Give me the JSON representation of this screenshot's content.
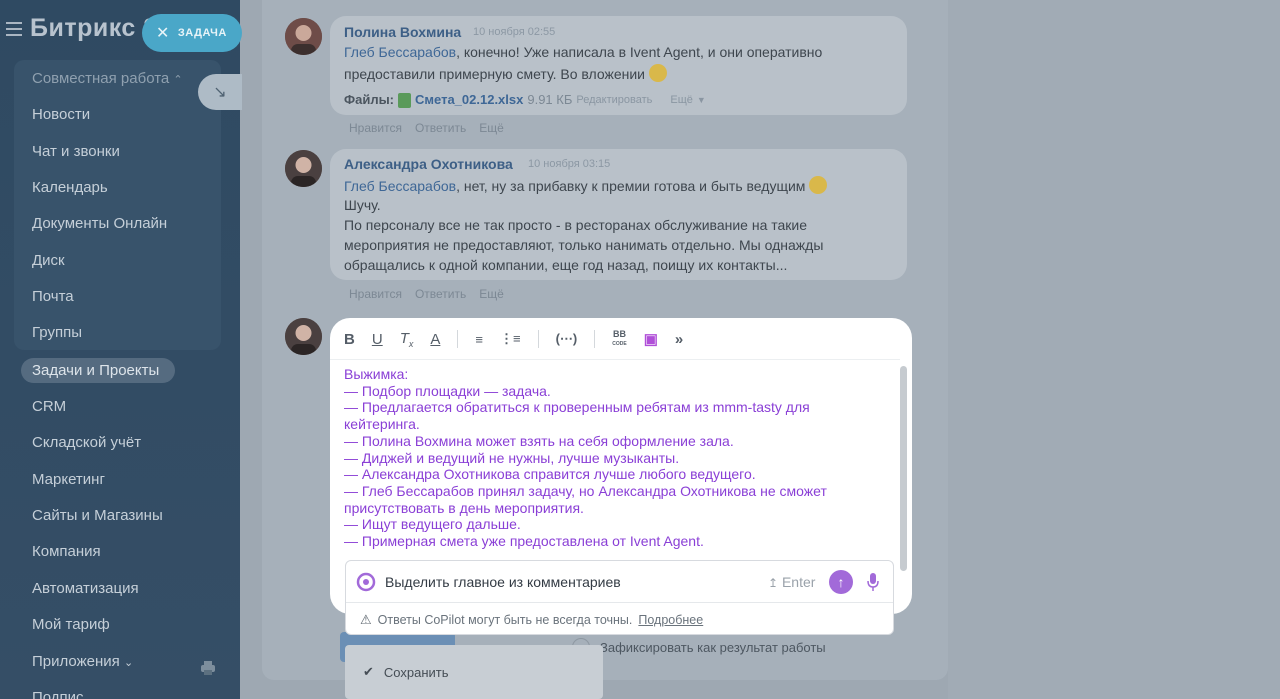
{
  "sidebar": {
    "brand": "Битрикс 2",
    "task_button": "ЗАДАЧА",
    "group_label": "Совместная работа",
    "items": [
      {
        "label": "Новости"
      },
      {
        "label": "Чат и звонки"
      },
      {
        "label": "Календарь"
      },
      {
        "label": "Документы Онлайн"
      },
      {
        "label": "Диск"
      },
      {
        "label": "Почта"
      },
      {
        "label": "Группы"
      },
      {
        "label": "Задачи и Проекты"
      },
      {
        "label": "CRM"
      },
      {
        "label": "Складской учёт"
      },
      {
        "label": "Маркетинг"
      },
      {
        "label": "Сайты и Магазины"
      },
      {
        "label": "Компания"
      },
      {
        "label": "Автоматизация"
      },
      {
        "label": "Мой тариф"
      },
      {
        "label": "Приложения"
      },
      {
        "label": "Подпис..."
      }
    ]
  },
  "comments": [
    {
      "author": "Полина Вохмина",
      "time": "10 ноября 02:55",
      "mention": "Глеб Бессарабов",
      "text_line1": ", конечно! Уже написала в Ivent Agent, и они оперативно",
      "text_line2": "предоставили примерную смету. Во вложении",
      "files_label": "Файлы:",
      "file_name": "Смета_02.12.xlsx",
      "file_size": "9.91 КБ",
      "file_edit": "Редактировать",
      "file_more": "Ещё",
      "actions": [
        "Нравится",
        "Ответить",
        "Ещё"
      ]
    },
    {
      "author": "Александра Охотникова",
      "time": "10 ноября 03:15",
      "mention": "Глеб Бессарабов",
      "text_line1": ", нет, ну за прибавку к премии готова и быть ведущим",
      "text_line2": "Шучу.",
      "text_line3": "По персоналу все не так просто - в ресторанах обслуживание на такие",
      "text_line4": "мероприятия не предоставляют, только нанимать отдельно. Мы однажды",
      "text_line5": "обращались к одной компании, еще год назад, поищу их контакты...",
      "actions": [
        "Нравится",
        "Ответить",
        "Ещё"
      ]
    }
  ],
  "editor": {
    "toolbar": [
      "B",
      "U",
      "Tx",
      "A",
      "ordered-list",
      "bullet-list",
      "code",
      "BB CODE",
      "copilot-image",
      "more"
    ],
    "summary_lines": [
      "Выжимка:",
      "— Подбор площадки — задача.",
      "— Предлагается обратиться к проверенным ребятам из mmm-tasty для",
      "кейтеринга.",
      "— Полина Вохмина может взять на себя оформление зала.",
      "— Диджей и ведущий не нужны, лучше музыканты.",
      "— Александра Охотникова справится лучше любого ведущего.",
      "— Глеб Бессарабов принял задачу, но Александра Охотникова не сможет",
      "присутствовать в день мероприятия.",
      "— Ищут ведущего дальше.",
      "— Примерная смета уже предоставлена от Ivent Agent."
    ]
  },
  "copilot": {
    "input_value": "Выделить главное из комментариев",
    "enter_hint": "Enter",
    "disclaimer": "Ответы CoPilot могут быть не всегда точны.",
    "more_link": "Подробнее"
  },
  "footer": {
    "save_label": "Сохранить",
    "fix_result_label": "Зафиксировать как результат работы"
  },
  "colors": {
    "sidebar_bg": "#2f4a62",
    "summary_text": "#8a3fd6",
    "copilot_accent": "#a26ad9",
    "mention": "#3e6796"
  }
}
